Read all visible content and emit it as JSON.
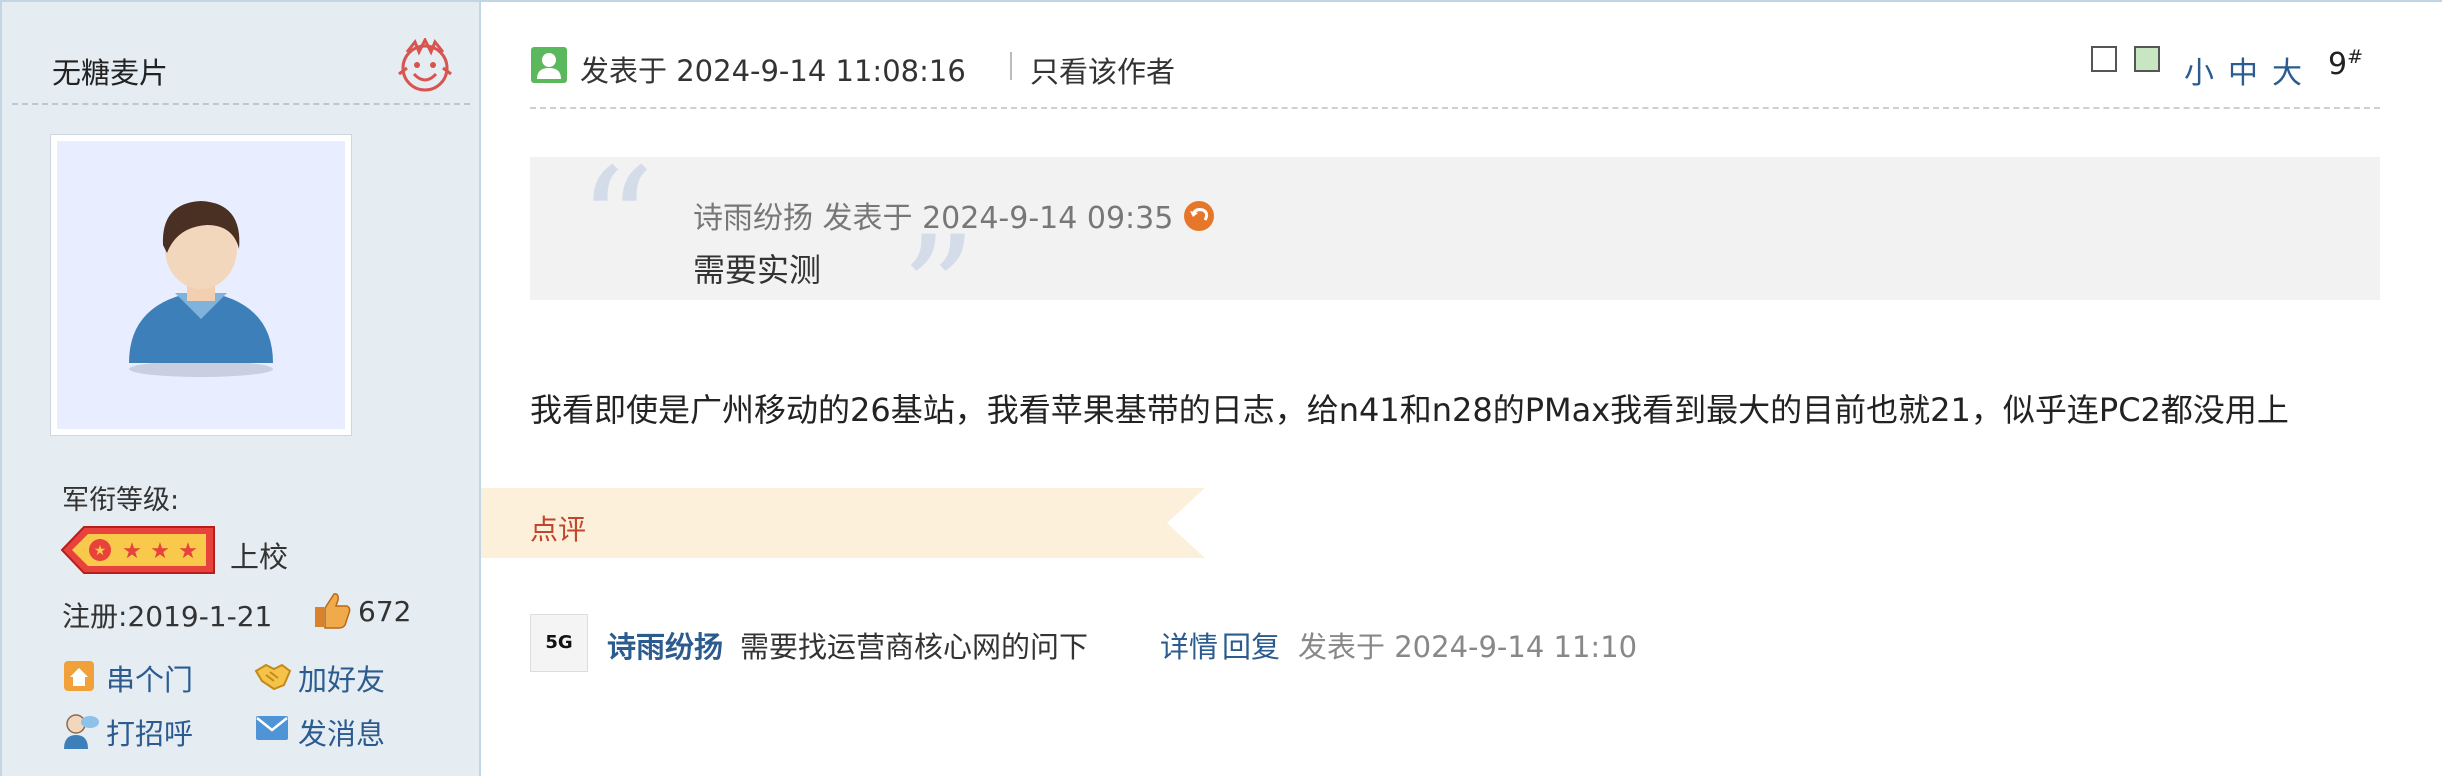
{
  "author": {
    "name": "无糖麦片",
    "rank_label": "军衔等级:",
    "rank_name": "上校",
    "register_label": "注册:",
    "register_date": "2019-1-21",
    "likes": "672",
    "actions": {
      "visit": "串个门",
      "add_friend": "加好友",
      "greet": "打招呼",
      "message": "发消息"
    }
  },
  "post": {
    "posted_at": "发表于 2024-9-14 11:08:16",
    "author_only": "只看该作者",
    "font_sizes": [
      "小",
      "中",
      "大"
    ],
    "floor": "9",
    "floor_mark": "#",
    "quote": {
      "meta": "诗雨纷扬 发表于 2024-9-14 09:35",
      "text": "需要实测"
    },
    "body": "我看即使是广州移动的26基站，我看苹果基带的日志，给n41和n28的PMax我看到最大的目前也就21，似乎连PC2都没用上"
  },
  "comments": {
    "label": "点评",
    "items": [
      {
        "avatar_text": "5G",
        "user": "诗雨纷扬",
        "text": "需要找运营商核心网的问下",
        "detail": "详情",
        "reply": "回复",
        "time": "发表于 2024-9-14 11:10"
      }
    ]
  },
  "colors": {
    "sidebar_bg": "#e5edf2",
    "link": "#2b5b8f",
    "comment_band": "#fdf0db",
    "comment_label": "#c0462c"
  }
}
